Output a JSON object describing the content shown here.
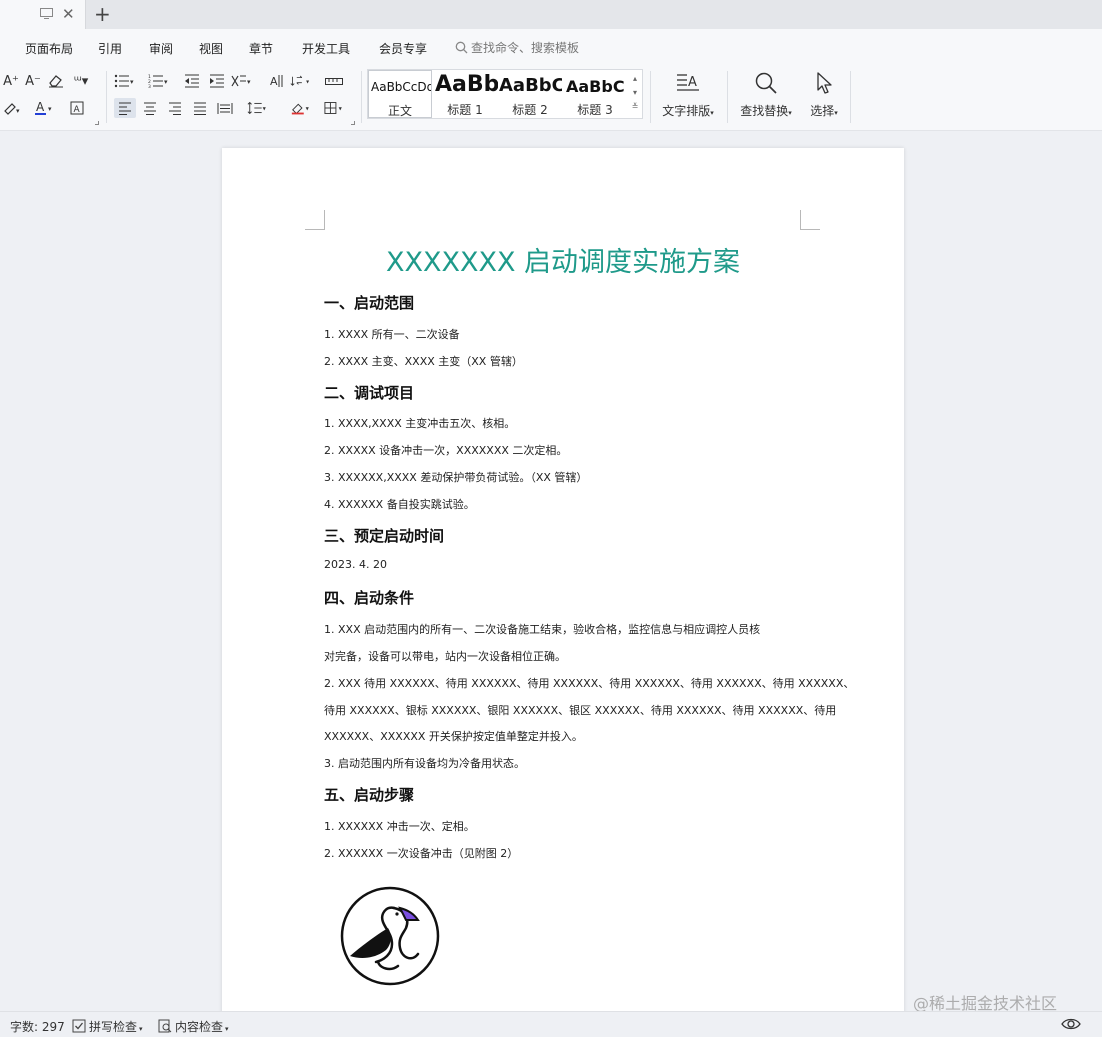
{
  "tabs": {
    "close": "✕",
    "add": "+"
  },
  "menu": {
    "items": [
      "页面布局",
      "引用",
      "审阅",
      "视图",
      "章节",
      "开发工具",
      "会员专享"
    ],
    "search_placeholder": "查找命令、搜索模板"
  },
  "toolbar": {
    "styles": [
      {
        "sample": "AaBbCcDd",
        "name": "正文"
      },
      {
        "sample": "AaBb",
        "name": "标题 1"
      },
      {
        "sample": "AaBbC",
        "name": "标题 2"
      },
      {
        "sample": "AaBbC",
        "name": "标题 3"
      }
    ],
    "text_layout": "文字排版",
    "find_replace": "查找替换",
    "select": "选择"
  },
  "document": {
    "title": "XXXXXXX 启动调度实施方案",
    "sections": [
      {
        "heading": "一、启动范围",
        "lines": [
          "1. XXXX 所有一、二次设备",
          "2. XXXX 主变、XXXX 主变（XX 管辖）"
        ]
      },
      {
        "heading": "二、调试项目",
        "lines": [
          "1. XXXX,XXXX 主变冲击五次、核相。",
          "2. XXXXX 设备冲击一次，XXXXXXX 二次定相。",
          "3. XXXXXX,XXXX 差动保护带负荷试验。（XX 管辖）",
          "4. XXXXXX 备自投实跳试验。"
        ]
      },
      {
        "heading": "三、预定启动时间",
        "lines": [
          "2023. 4. 20"
        ]
      },
      {
        "heading": "四、启动条件",
        "lines": [
          "1. XXX 启动范围内的所有一、二次设备施工结束，验收合格，监控信息与相应调控人员核",
          "对完备，设备可以带电，站内一次设备相位正确。",
          "2. XXX 待用 XXXXXX、待用 XXXXXX、待用 XXXXXX、待用 XXXXXX、待用 XXXXXX、待用 XXXXXX、",
          "待用 XXXXXX、银标 XXXXXX、银阳 XXXXXX、银区 XXXXXX、待用 XXXXXX、待用 XXXXXX、待用",
          "XXXXXX、XXXXXX 开关保护按定值单整定并投入。",
          "3. 启动范围内所有设备均为冷备用状态。"
        ]
      },
      {
        "heading": "五、启动步骤",
        "lines": [
          "1. XXXXXX 冲击一次、定相。",
          "2. XXXXXX 一次设备冲击（见附图 2）"
        ]
      }
    ]
  },
  "status": {
    "word_count": "字数: 297",
    "spell_check": "拼写检查",
    "content_check": "内容检查"
  },
  "watermark": "@稀土掘金技术社区",
  "colors": {
    "title": "#1f9a8a",
    "logo_accent": "#7b4fe0"
  }
}
